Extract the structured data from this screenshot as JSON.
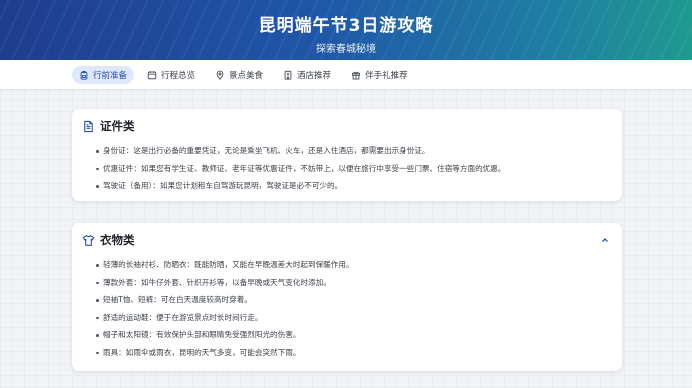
{
  "hero": {
    "title": "昆明端午节3日游攻略",
    "subtitle": "探索春城秘境"
  },
  "nav": {
    "tabs": [
      {
        "label": "行前准备",
        "icon": "backpack-icon",
        "active": true
      },
      {
        "label": "行程总览",
        "icon": "calendar-icon",
        "active": false
      },
      {
        "label": "景点美食",
        "icon": "map-pin-icon",
        "active": false
      },
      {
        "label": "酒店推荐",
        "icon": "hotel-icon",
        "active": false
      },
      {
        "label": "伴手礼推荐",
        "icon": "gift-icon",
        "active": false
      }
    ]
  },
  "sections": {
    "documents": {
      "title": "证件类",
      "icon": "document-icon",
      "items": [
        "身份证：这是出行必备的重要凭证，无论是乘坐飞机、火车，还是入住酒店，都需要出示身份证。",
        "优惠证件：如果您有学生证、教师证、老年证等优惠证件，不妨带上，以便在旅行中享受一些门票、住宿等方面的优惠。",
        "驾驶证（备用）：如果您计划租车自驾游玩昆明，驾驶证是必不可少的。"
      ]
    },
    "clothing": {
      "title": "衣物类",
      "icon": "shirt-icon",
      "collapse_icon": "chevron-up-icon",
      "items": [
        "轻薄的长袖衬衫、防晒衣：既能防晒，又能在早晚温差大时起到保暖作用。",
        "薄款外套：如牛仔外套、针织开衫等，以备早晚或天气变化时添加。",
        "短袖T恤、短裤：可在白天温度较高时穿着。",
        "舒适的运动鞋：便于在游览景点时长时间行走。",
        "帽子和太阳镜：有效保护头部和眼睛免受强烈阳光的伤害。",
        "雨具：如雨伞或雨衣，昆明的天气多变，可能会突然下雨。"
      ]
    }
  },
  "colors": {
    "accent": "#2450b8",
    "active_tab_bg": "#dfe8fb",
    "hero_gradient_start": "#1f3d8f",
    "hero_gradient_end": "#1f9a8e"
  }
}
